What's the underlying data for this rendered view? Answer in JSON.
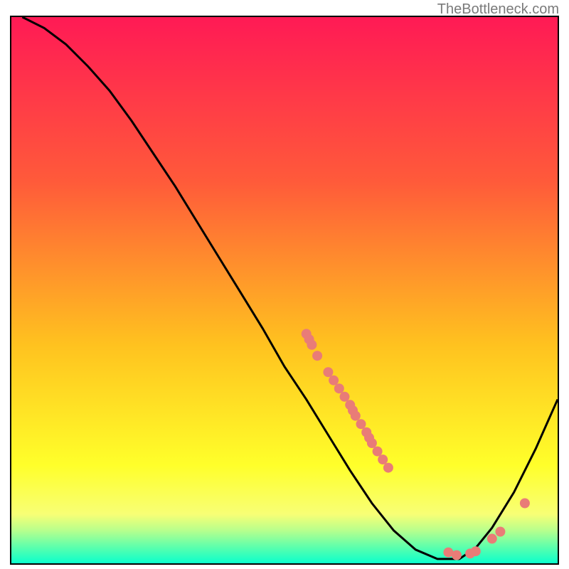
{
  "attribution": "TheBottleneck.com",
  "chart_data": {
    "type": "line",
    "title": "",
    "xlabel": "",
    "ylabel": "",
    "xlim": [
      0,
      100
    ],
    "ylim": [
      0,
      100
    ],
    "curve": [
      {
        "x": 2,
        "y": 100
      },
      {
        "x": 6,
        "y": 98
      },
      {
        "x": 10,
        "y": 95
      },
      {
        "x": 14,
        "y": 91
      },
      {
        "x": 18,
        "y": 86.5
      },
      {
        "x": 22,
        "y": 81
      },
      {
        "x": 26,
        "y": 75
      },
      {
        "x": 30,
        "y": 69
      },
      {
        "x": 34,
        "y": 62.5
      },
      {
        "x": 38,
        "y": 56
      },
      {
        "x": 42,
        "y": 49.5
      },
      {
        "x": 46,
        "y": 43
      },
      {
        "x": 50,
        "y": 36
      },
      {
        "x": 54,
        "y": 30
      },
      {
        "x": 58,
        "y": 23.5
      },
      {
        "x": 62,
        "y": 17
      },
      {
        "x": 66,
        "y": 11
      },
      {
        "x": 70,
        "y": 6
      },
      {
        "x": 74,
        "y": 2.5
      },
      {
        "x": 78,
        "y": 0.8
      },
      {
        "x": 82,
        "y": 0.8
      },
      {
        "x": 85,
        "y": 2.8
      },
      {
        "x": 88,
        "y": 6.5
      },
      {
        "x": 92,
        "y": 13
      },
      {
        "x": 96,
        "y": 21
      },
      {
        "x": 100,
        "y": 30
      }
    ],
    "markers": [
      {
        "x": 54,
        "y": 42
      },
      {
        "x": 54.5,
        "y": 41
      },
      {
        "x": 55,
        "y": 40
      },
      {
        "x": 56,
        "y": 38
      },
      {
        "x": 58,
        "y": 35
      },
      {
        "x": 59,
        "y": 33.5
      },
      {
        "x": 60,
        "y": 32
      },
      {
        "x": 61,
        "y": 30.5
      },
      {
        "x": 62,
        "y": 29
      },
      {
        "x": 62.5,
        "y": 28
      },
      {
        "x": 63,
        "y": 27
      },
      {
        "x": 64,
        "y": 25.5
      },
      {
        "x": 65,
        "y": 24
      },
      {
        "x": 65.5,
        "y": 23
      },
      {
        "x": 66,
        "y": 22
      },
      {
        "x": 67,
        "y": 20.5
      },
      {
        "x": 68,
        "y": 19
      },
      {
        "x": 69,
        "y": 17.5
      },
      {
        "x": 80,
        "y": 2
      },
      {
        "x": 81.5,
        "y": 1.5
      },
      {
        "x": 84,
        "y": 1.8
      },
      {
        "x": 85,
        "y": 2.2
      },
      {
        "x": 88,
        "y": 4.5
      },
      {
        "x": 89.5,
        "y": 5.8
      },
      {
        "x": 94,
        "y": 11
      }
    ],
    "gradient_bands": [
      {
        "y0": 100,
        "y1": 70,
        "c0": "#ff1a55",
        "c1": "#ff5a3a"
      },
      {
        "y0": 70,
        "y1": 40,
        "c0": "#ff5a3a",
        "c1": "#ffc21f"
      },
      {
        "y0": 40,
        "y1": 18,
        "c0": "#ffc21f",
        "c1": "#ffff2a"
      },
      {
        "y0": 18,
        "y1": 9,
        "c0": "#ffff2a",
        "c1": "#f8ff75"
      },
      {
        "y0": 9,
        "y1": 6,
        "c0": "#f8ff75",
        "c1": "#b7ff8d"
      },
      {
        "y0": 6,
        "y1": 3,
        "c0": "#b7ff8d",
        "c1": "#5dffac"
      },
      {
        "y0": 3,
        "y1": 0,
        "c0": "#5dffac",
        "c1": "#0bffcc"
      }
    ],
    "marker_color": "#e97c77",
    "curve_color": "#000000"
  }
}
